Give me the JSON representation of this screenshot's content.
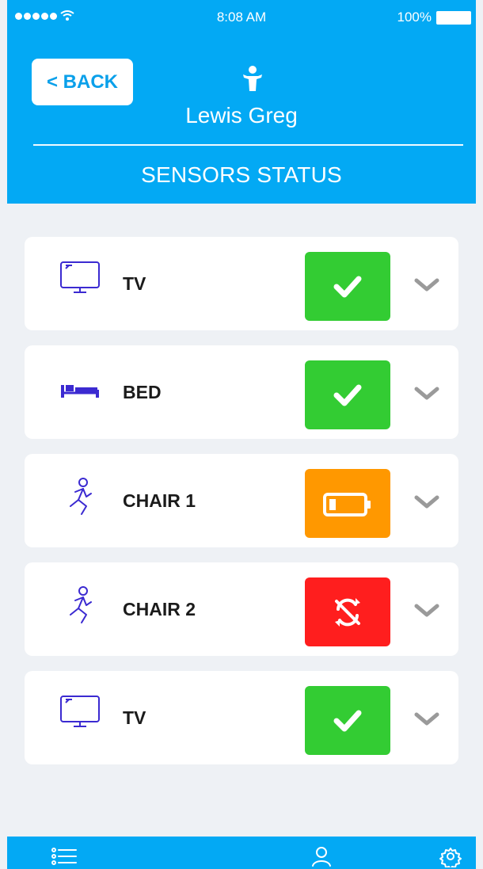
{
  "colors": {
    "primary": "#03a9f4",
    "ok": "#33cc33",
    "warning": "#ff9800",
    "error": "#ff1e1e",
    "icon": "#3b2ad1",
    "chevron": "#9a9a9a"
  },
  "statusbar": {
    "time": "8:08 AM",
    "battery": "100%"
  },
  "header": {
    "back_label": "< BACK",
    "patient_name": "Lewis Greg",
    "title": "SENSORS STATUS"
  },
  "sensors": [
    {
      "label": "TV",
      "icon": "tv-icon",
      "status": "ok"
    },
    {
      "label": "BED",
      "icon": "bed-icon",
      "status": "ok"
    },
    {
      "label": "CHAIR 1",
      "icon": "running-person-icon",
      "status": "low-battery"
    },
    {
      "label": "CHAIR 2",
      "icon": "running-person-icon",
      "status": "sync-off"
    },
    {
      "label": "TV",
      "icon": "tv-icon",
      "status": "ok"
    }
  ],
  "bottom_nav": [
    {
      "name": "list-icon"
    },
    {
      "name": "user-icon"
    },
    {
      "name": "settings-icon"
    }
  ]
}
